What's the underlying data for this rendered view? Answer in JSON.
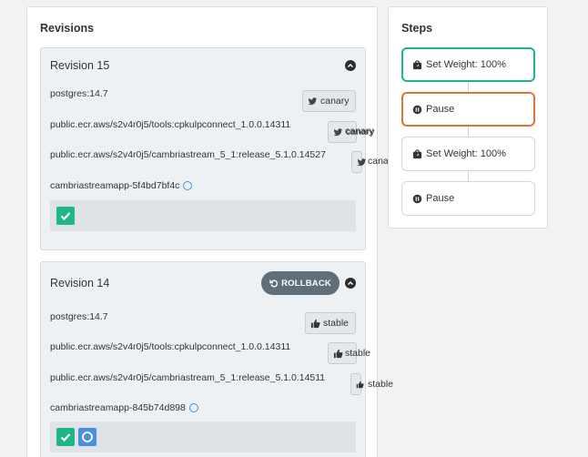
{
  "revisions_panel": {
    "title": "Revisions",
    "revisions": [
      {
        "title": "Revision 15",
        "images": [
          {
            "name": "postgres:14.7",
            "tag": "canary"
          },
          {
            "name": "public.ecr.aws/s2v4r0j5/tools:cpkulpconnect_1.0.0.14311",
            "tag": "canary"
          },
          {
            "name": "public.ecr.aws/s2v4r0j5/cambriastream_5_1:release_5.1.0.14527",
            "tag": "canary"
          }
        ],
        "replicaset": "cambriastreamapp-5f4bd7bf4c"
      },
      {
        "title": "Revision 14",
        "rollback_label": "ROLLBACK",
        "images": [
          {
            "name": "postgres:14.7",
            "tag": "stable"
          },
          {
            "name": "public.ecr.aws/s2v4r0j5/tools:cpkulpconnect_1.0.0.14311",
            "tag": "stable"
          },
          {
            "name": "public.ecr.aws/s2v4r0j5/cambriastream_5_1:release_5.1.0.14511",
            "tag": "stable"
          }
        ],
        "replicaset": "cambriastreamapp-845b74d898"
      }
    ]
  },
  "steps_panel": {
    "title": "Steps",
    "steps": [
      {
        "label": "Set Weight: 100%",
        "icon": "weight-icon",
        "state": "complete"
      },
      {
        "label": "Pause",
        "icon": "pause-icon",
        "state": "current"
      },
      {
        "label": "Set Weight: 100%",
        "icon": "weight-icon",
        "state": "pending"
      },
      {
        "label": "Pause",
        "icon": "pause-icon",
        "state": "pending"
      }
    ]
  },
  "colors": {
    "complete": "#1fb686",
    "current": "#e0743a",
    "progress": "#4a90e2",
    "rollback": "#5f6e78"
  }
}
